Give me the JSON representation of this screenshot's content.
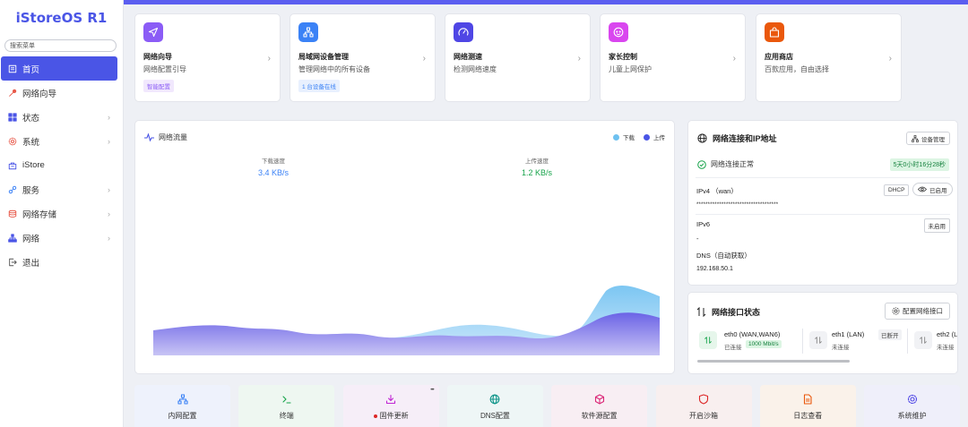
{
  "app": {
    "title": "iStoreOS R1",
    "search_placeholder": "搜索菜单"
  },
  "sidebar": {
    "items": [
      {
        "label": "首页",
        "icon": "home-icon",
        "active": true
      },
      {
        "label": "网络向导",
        "icon": "wizard-icon"
      },
      {
        "label": "状态",
        "icon": "status-icon",
        "has_children": true
      },
      {
        "label": "系统",
        "icon": "gear-icon",
        "has_children": true
      },
      {
        "label": "iStore",
        "icon": "store-icon"
      },
      {
        "label": "服务",
        "icon": "services-icon",
        "has_children": true
      },
      {
        "label": "网络存储",
        "icon": "storage-icon",
        "has_children": true
      },
      {
        "label": "网络",
        "icon": "network-icon",
        "has_children": true
      },
      {
        "label": "退出",
        "icon": "logout-icon"
      }
    ]
  },
  "quick_cards": [
    {
      "title": "网络向导",
      "subtitle": "网络配置引导",
      "badge": "智能配置",
      "icon": "navigation-arrow-icon",
      "color": "#8b5cf6"
    },
    {
      "title": "局域网设备管理",
      "subtitle": "管理网络中的所有设备",
      "badge": "1 台设备在线",
      "icon": "lan-devices-icon",
      "color": "#3b82f6"
    },
    {
      "title": "网络测速",
      "subtitle": "检测网络速度",
      "badge": "",
      "icon": "speedometer-icon",
      "color": "#4f46e5"
    },
    {
      "title": "家长控制",
      "subtitle": "儿童上网保护",
      "badge": "",
      "icon": "baby-face-icon",
      "color": "#d946ef"
    },
    {
      "title": "应用商店",
      "subtitle": "百款应用，自由选择",
      "badge": "",
      "icon": "shopping-bag-icon",
      "color": "#ea580c"
    }
  ],
  "traffic": {
    "title": "网络流量",
    "legend": {
      "download": "下载",
      "upload": "上传"
    },
    "download_label": "下载速度",
    "download_value": "3.4 KB/s",
    "upload_label": "上传速度",
    "upload_value": "1.2 KB/s",
    "colors": {
      "download": "#6ec1f0",
      "upload": "#4a55e6"
    }
  },
  "connection": {
    "title": "网络连接和IP地址",
    "device_mgmt_btn": "设备管理",
    "status": "网络连接正常",
    "uptime": "5天0小时16分28秒",
    "ipv4_label": "IPv4 （wan）",
    "ipv4_mode": "DHCP",
    "ipv4_toggle": "已启用",
    "ipv4_value": "************************************",
    "ipv6_label": "IPv6",
    "ipv6_status": "未启用",
    "ipv6_value": "-",
    "dns_label": "DNS（自动获取）",
    "dns_value": "192.168.50.1"
  },
  "interfaces": {
    "title": "网络接口状态",
    "config_btn": "配置网络接口",
    "ports": [
      {
        "name": "eth0 (WAN,WAN6)",
        "status": "已连接",
        "speed": "1000 Mbit/s",
        "tag": ""
      },
      {
        "name": "eth1 (LAN)",
        "status": "未连接",
        "speed": "",
        "tag": "已断开"
      },
      {
        "name": "eth2 (L",
        "status": "未连接",
        "speed": "",
        "tag": ""
      }
    ]
  },
  "tools": [
    {
      "label": "内网配置",
      "icon": "lan-config-icon",
      "color": "#3b82f6",
      "bg": "#eef2fc"
    },
    {
      "label": "终端",
      "icon": "terminal-icon",
      "color": "#16a34a",
      "bg": "#eef7f1"
    },
    {
      "label": "固件更新",
      "icon": "download-icon",
      "color": "#c026d3",
      "bg": "#f6eef8",
      "dot": "#dc2626",
      "more": "•••"
    },
    {
      "label": "DNS配置",
      "icon": "globe-icon",
      "color": "#0d9488",
      "bg": "#eef6f6"
    },
    {
      "label": "软件源配置",
      "icon": "package-icon",
      "color": "#db2777",
      "bg": "#f8eef3"
    },
    {
      "label": "开启沙箱",
      "icon": "shield-icon",
      "color": "#dc2626",
      "bg": "#f8efef"
    },
    {
      "label": "日志查看",
      "icon": "document-icon",
      "color": "#ea580c",
      "bg": "#faf2ea"
    },
    {
      "label": "系统维护",
      "icon": "gear-icon",
      "color": "#4f46e5",
      "bg": "#efeffa"
    }
  ]
}
